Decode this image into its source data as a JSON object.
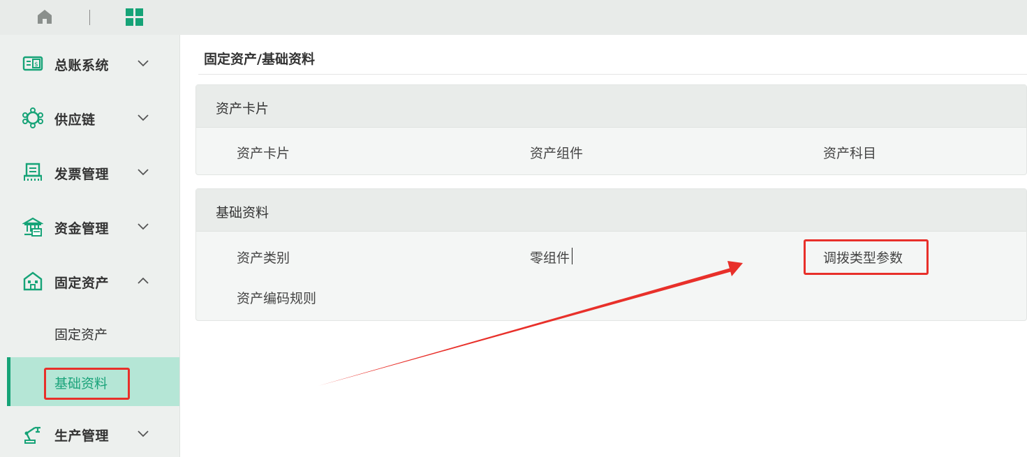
{
  "topbar": {
    "home_icon": "home-icon",
    "apps_icon": "apps-grid-icon"
  },
  "sidebar": {
    "items": [
      {
        "label": "总账系统",
        "icon": "ledger-icon",
        "expanded": false
      },
      {
        "label": "供应链",
        "icon": "supply-chain-icon",
        "expanded": false
      },
      {
        "label": "发票管理",
        "icon": "invoice-icon",
        "expanded": false
      },
      {
        "label": "资金管理",
        "icon": "bank-icon",
        "expanded": false
      },
      {
        "label": "固定资产",
        "icon": "building-icon",
        "expanded": true,
        "children": [
          {
            "label": "固定资产"
          },
          {
            "label": "基础资料",
            "active": true
          }
        ]
      },
      {
        "label": "生产管理",
        "icon": "robot-arm-icon",
        "expanded": false
      }
    ]
  },
  "main": {
    "breadcrumb": "固定资产/基础资料",
    "cards": [
      {
        "title": "资产卡片",
        "items": [
          "资产卡片",
          "资产组件",
          "资产科目"
        ]
      },
      {
        "title": "基础资料",
        "items": [
          "资产类别",
          "零组件",
          "调拨类型参数",
          "资产编码规则"
        ]
      }
    ]
  },
  "colors": {
    "accent": "#16a377",
    "highlight": "#e8302a",
    "active_bg": "#b5e6d6"
  }
}
